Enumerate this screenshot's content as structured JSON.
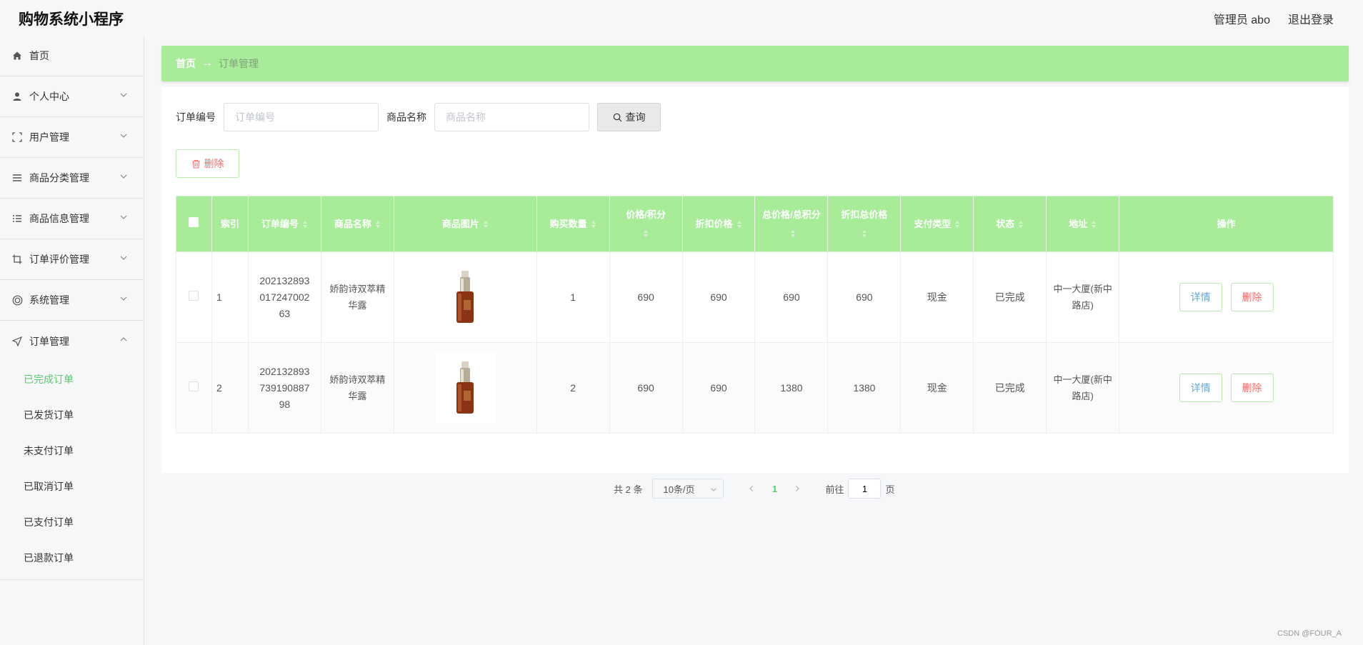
{
  "app": {
    "title": "购物系统小程序"
  },
  "header": {
    "user": "管理员 abo",
    "logout": "退出登录"
  },
  "sidebar": {
    "items": [
      {
        "label": "首页",
        "icon": "home-icon"
      },
      {
        "label": "个人中心",
        "icon": "user-icon"
      },
      {
        "label": "用户管理",
        "icon": "frame-icon"
      },
      {
        "label": "商品分类管理",
        "icon": "list-icon"
      },
      {
        "label": "商品信息管理",
        "icon": "list-detail-icon"
      },
      {
        "label": "订单评价管理",
        "icon": "crop-icon"
      },
      {
        "label": "系统管理",
        "icon": "settings-ring-icon"
      },
      {
        "label": "订单管理",
        "icon": "send-icon"
      }
    ],
    "sub_items": [
      "已完成订单",
      "已发货订单",
      "未支付订单",
      "已取消订单",
      "已支付订单",
      "已退款订单"
    ]
  },
  "breadcrumb": {
    "home": "首页",
    "arrow": "→",
    "current": "订单管理"
  },
  "search": {
    "order_no_label": "订单编号",
    "order_no_placeholder": "订单编号",
    "product_name_label": "商品名称",
    "product_name_placeholder": "商品名称",
    "query_button": "查询"
  },
  "toolbar": {
    "delete_button": "删除"
  },
  "table": {
    "columns": [
      "索引",
      "订单编号",
      "商品名称",
      "商品图片",
      "购买数量",
      "价格/积分",
      "折扣价格",
      "总价格/总积分",
      "折扣总价格",
      "支付类型",
      "状态",
      "地址",
      "操作"
    ],
    "rows": [
      {
        "index": "1",
        "order_no": "202132893017247002 63",
        "order_no_lines": [
          "202132893",
          "017247002",
          "63"
        ],
        "product_name": "娇韵诗双萃精华露",
        "quantity": "1",
        "price": "690",
        "discount_price": "690",
        "total_price": "690",
        "discount_total": "690",
        "pay_type": "现金",
        "status": "已完成",
        "address": "中一大厦(新中路店)"
      },
      {
        "index": "2",
        "order_no": "202132893739190887 98",
        "order_no_lines": [
          "202132893",
          "739190887",
          "98"
        ],
        "product_name": "娇韵诗双萃精华露",
        "quantity": "2",
        "price": "690",
        "discount_price": "690",
        "total_price": "1380",
        "discount_total": "1380",
        "pay_type": "现金",
        "status": "已完成",
        "address": "中一大厦(新中路店)"
      }
    ],
    "detail_button": "详情",
    "delete_button": "删除"
  },
  "pagination": {
    "total": "共 2 条",
    "page_size": "10条/页",
    "current_page": "1",
    "goto_prefix": "前往",
    "goto_value": "1",
    "goto_suffix": "页"
  },
  "watermark": "CSDN @FOUR_A",
  "colors": {
    "accent": "#a8ec9a",
    "active": "#5bc96b",
    "danger": "#f56c6c",
    "info": "#5fa8d8"
  }
}
